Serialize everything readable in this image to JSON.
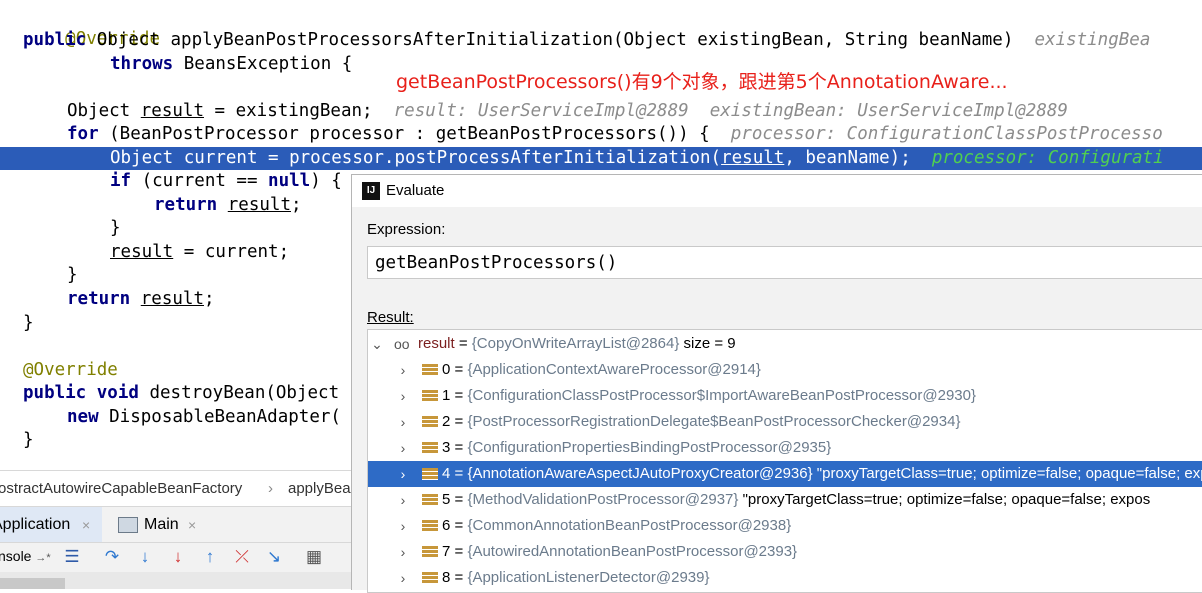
{
  "editor": {
    "lines": {
      "l1": "@Override",
      "l2_kw": "public",
      "l2_rest": " Object applyBeanPostProcessorsAfterInitialization(Object existingBean, String beanName)",
      "l2_hint": "existingBea",
      "l3_kw": "throws",
      "l3_rest": " BeansException {",
      "l4_a": "Object ",
      "l4_var": "result",
      "l4_b": " = existingBean;",
      "l4_hint": "result: UserServiceImpl@2889  existingBean: UserServiceImpl@2889",
      "l5_kw": "for",
      "l5_rest": " (BeanPostProcessor processor : getBeanPostProcessors()) {",
      "l5_hint": "processor: ConfigurationClassPostProcesso",
      "l6_a": "Object current = processor.postProcessAfterInitialization(",
      "l6_var": "result",
      "l6_b": ", beanName);",
      "l6_hint": "processor: Configurati",
      "l7_kw": "if",
      "l7_a": " (current == ",
      "l7_null": "null",
      "l7_b": ") {",
      "l8_kw": "return",
      "l8_var": "result",
      "l8_b": ";",
      "l9": "}",
      "l10_var": "result",
      "l10_b": " = current;",
      "l11": "}",
      "l12_kw": "return",
      "l12_var": "result",
      "l12_b": ";",
      "l13": "}",
      "l15": "@Override",
      "l16_kw1": "public",
      "l16_kw2": "void",
      "l16_rest": " destroyBean(Object",
      "l17_kw": "new",
      "l17_rest": " DisposableBeanAdapter(",
      "l18": "}"
    },
    "annotation_note": "getBeanPostProcessors()有9个对象，跟进第5个AnnotationAware..."
  },
  "debugger": {
    "breadcrumb": {
      "class": "ostractAutowireCapableBeanFactory",
      "sep": "›",
      "method": "applyBea"
    },
    "tabs": [
      {
        "label": "Application",
        "close": "×"
      },
      {
        "label": "Main",
        "close": "×"
      }
    ],
    "toolbar": {
      "console_label": "nsole",
      "console_arrow": "→*"
    }
  },
  "evaluate_dialog": {
    "title": "Evaluate",
    "expression_label": "Expression:",
    "expression_value": "getBeanPostProcessors()",
    "result_label": "Result:",
    "root": {
      "name": "result",
      "value": "{CopyOnWriteArrayList@2864}",
      "size": "size = 9"
    },
    "items": [
      {
        "index": "0",
        "value": "{ApplicationContextAwareProcessor@2914}",
        "extra": ""
      },
      {
        "index": "1",
        "value": "{ConfigurationClassPostProcessor$ImportAwareBeanPostProcessor@2930}",
        "extra": ""
      },
      {
        "index": "2",
        "value": "{PostProcessorRegistrationDelegate$BeanPostProcessorChecker@2934}",
        "extra": ""
      },
      {
        "index": "3",
        "value": "{ConfigurationPropertiesBindingPostProcessor@2935}",
        "extra": ""
      },
      {
        "index": "4",
        "value": "{AnnotationAwareAspectJAutoProxyCreator@2936}",
        "extra": "\"proxyTargetClass=true; optimize=false; opaque=false; expo"
      },
      {
        "index": "5",
        "value": "{MethodValidationPostProcessor@2937}",
        "extra": "\"proxyTargetClass=true; optimize=false; opaque=false; expos"
      },
      {
        "index": "6",
        "value": "{CommonAnnotationBeanPostProcessor@2938}",
        "extra": ""
      },
      {
        "index": "7",
        "value": "{AutowiredAnnotationBeanPostProcessor@2393}",
        "extra": ""
      },
      {
        "index": "8",
        "value": "{ApplicationListenerDetector@2939}",
        "extra": ""
      }
    ],
    "selected_index": 4
  },
  "colors": {
    "current_line": "#2b5cb8",
    "selected_row": "#2e6bc6",
    "note_red": "#e8201a"
  }
}
